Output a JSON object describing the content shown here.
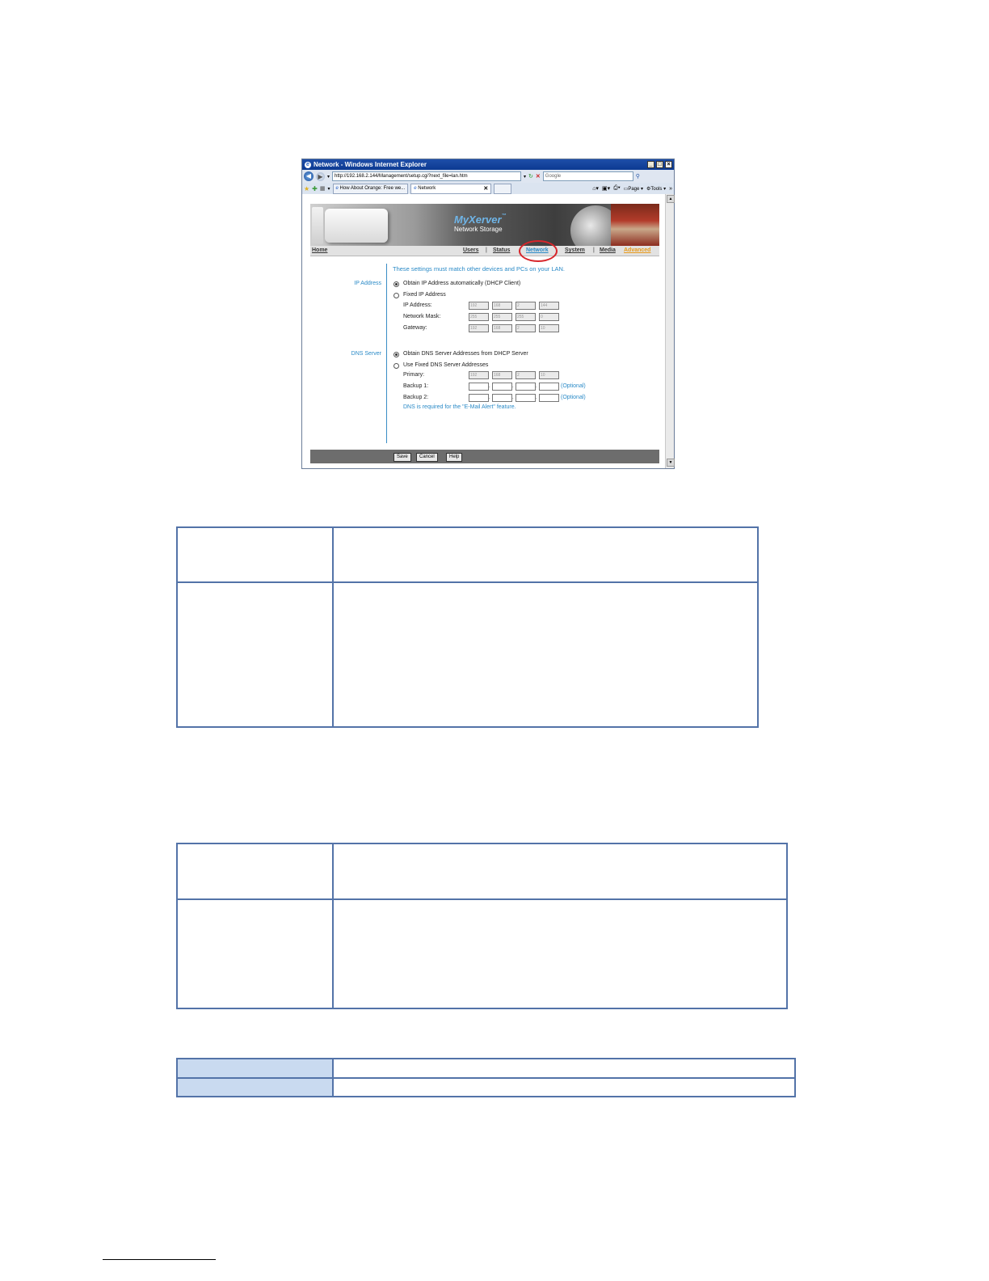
{
  "browser": {
    "title": "Network - Windows Internet Explorer",
    "window_controls": [
      "_",
      "□",
      "×"
    ],
    "url": "http://192.168.2.144/Management/setup.cgi?next_file=lan.htm",
    "search_placeholder": "Google",
    "tabs": [
      "How About Orange: Free we...",
      "Network"
    ],
    "command_bar": [
      "Page ▾",
      "Tools ▾"
    ]
  },
  "page": {
    "brand": "MyXerver",
    "brand_tm": "™",
    "brand_sub": "Network Storage",
    "nav": {
      "home": "Home",
      "users": "Users",
      "status": "Status",
      "network": "Network",
      "system": "System",
      "media": "Media",
      "advanced": "Advanced",
      "sep": "|"
    },
    "intro": "These settings must match other devices and PCs on your LAN.",
    "ip_section": {
      "label": "IP Address",
      "opt_auto": "Obtain IP Address automatically (DHCP Client)",
      "opt_fixed": "Fixed IP Address",
      "ip_label": "IP Address:",
      "ip": [
        "192",
        "168",
        "2",
        "144"
      ],
      "mask_label": "Network Mask:",
      "mask": [
        "255",
        "255",
        "255",
        "0"
      ],
      "gw_label": "Gateway:",
      "gw": [
        "192",
        "168",
        "2",
        "10"
      ]
    },
    "dns_section": {
      "label": "DNS Server",
      "opt_auto": "Obtain DNS Server Addresses from DHCP Server",
      "opt_fixed": "Use Fixed DNS Server Addresses",
      "primary_label": "Primary:",
      "primary": [
        "192",
        "168",
        "2",
        "10"
      ],
      "backup1_label": "Backup 1:",
      "backup2_label": "Backup 2:",
      "optional": "(Optional)",
      "note": "DNS is required for the \"E-Mail Alert\" feature."
    },
    "buttons": {
      "save": "Save",
      "cancel": "Cancel",
      "help": "Help"
    }
  }
}
